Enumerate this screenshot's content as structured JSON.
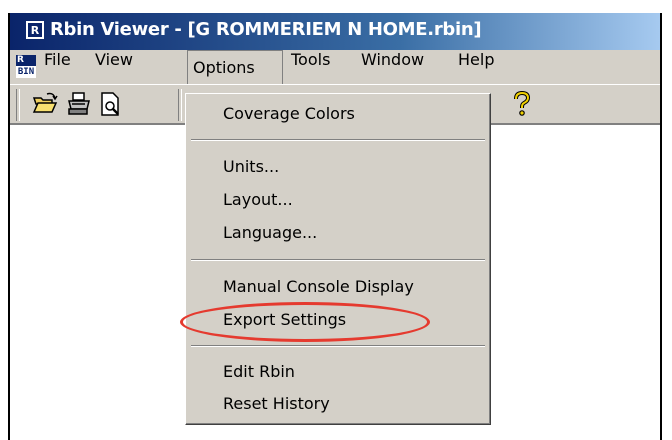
{
  "window": {
    "app_icon": "R",
    "title": "Rbin Viewer - [G ROMMERIEM N HOME.rbin]"
  },
  "menubar": {
    "logo_top": "R",
    "logo_bottom": "BIN",
    "items": [
      "File",
      "View",
      "Options",
      "Tools",
      "Window",
      "Help"
    ]
  },
  "toolbar": {
    "icons": [
      "open-folder-icon",
      "print-icon",
      "print-preview-icon",
      "help-icon"
    ]
  },
  "options_menu": {
    "groups": [
      [
        "Coverage Colors"
      ],
      [
        "Units...",
        "Layout...",
        "Language..."
      ],
      [
        "Manual Console Display",
        "Export Settings"
      ],
      [
        "Edit Rbin",
        "Reset History"
      ]
    ]
  },
  "annotation": {
    "highlight_color": "#e53a2f",
    "highlighted_item": "Export Settings"
  }
}
